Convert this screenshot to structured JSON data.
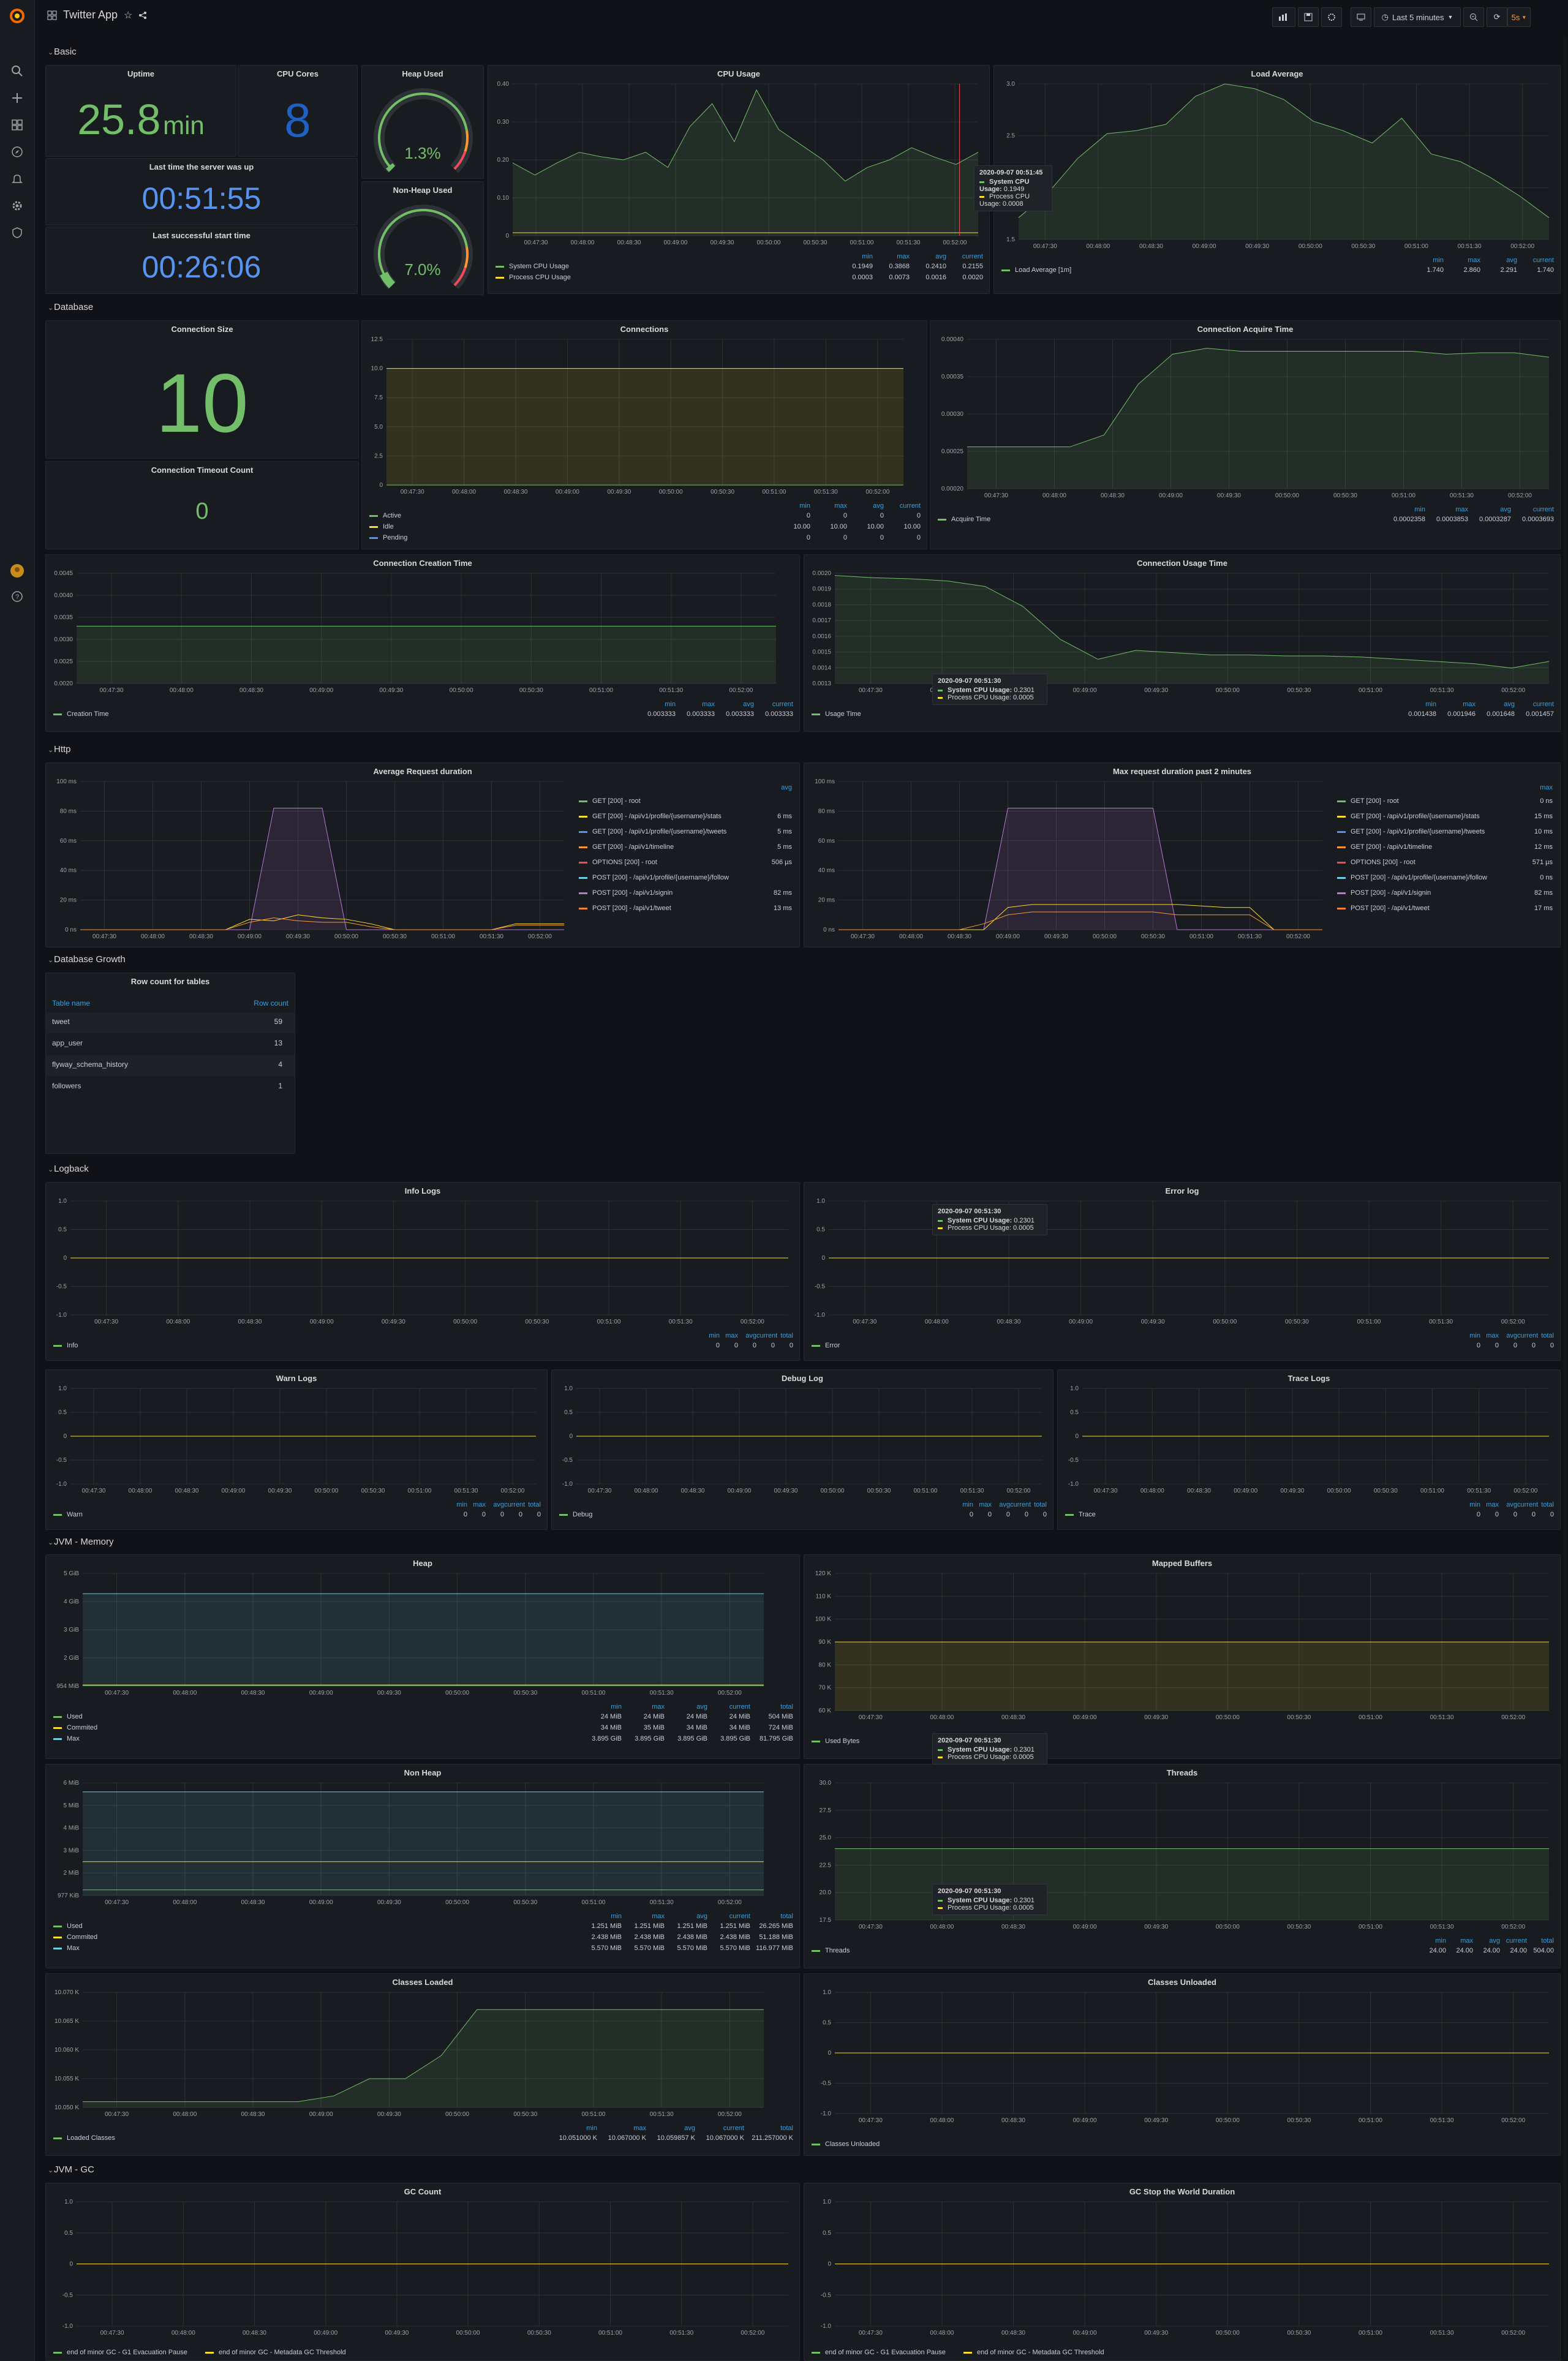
{
  "app": {
    "title": "Twitter App",
    "time_range": "Last 5 minutes",
    "refresh": "5s"
  },
  "rows": {
    "basic": "Basic",
    "database": "Database",
    "http": "Http",
    "db_growth": "Database Growth",
    "logback": "Logback",
    "jvm_memory": "JVM - Memory",
    "jvm_gc": "JVM - GC"
  },
  "time_ticks": [
    "00:47:30",
    "00:48:00",
    "00:48:30",
    "00:49:00",
    "00:49:30",
    "00:50:00",
    "00:50:30",
    "00:51:00",
    "00:51:30",
    "00:52:00"
  ],
  "stats": {
    "uptime": {
      "title": "Uptime",
      "value": "25.8",
      "unit": "min"
    },
    "cpu_cores": {
      "title": "CPU Cores",
      "value": "8"
    },
    "heap_used": {
      "title": "Heap Used",
      "value": "1.3%",
      "level": 0.013
    },
    "nonheap_used": {
      "title": "Non-Heap Used",
      "value": "7.0%",
      "level": 0.07
    },
    "last_up": {
      "title": "Last time the server was up",
      "value": "00:51:55"
    },
    "last_start": {
      "title": "Last successful start time",
      "value": "00:26:06"
    },
    "conn_size": {
      "title": "Connection Size",
      "value": "10"
    },
    "conn_timeout": {
      "title": "Connection Timeout Count",
      "value": "0"
    }
  },
  "panels": {
    "cpu_usage": {
      "title": "CPU Usage",
      "yticks": [
        "0.40",
        "0.30",
        "0.20",
        "0.10",
        "0"
      ],
      "legend_heads": [
        "min",
        "max",
        "avg",
        "current"
      ],
      "legend": [
        {
          "name": "System CPU Usage",
          "vals": [
            "0.1949",
            "0.3868",
            "0.2410",
            "0.2155"
          ]
        },
        {
          "name": "Process CPU Usage",
          "vals": [
            "0.0003",
            "0.0073",
            "0.0016",
            "0.0020"
          ]
        }
      ]
    },
    "load_avg": {
      "title": "Load Average",
      "yticks": [
        "3.0",
        "2.5",
        "2.0",
        "1.5"
      ],
      "legend_heads": [
        "min",
        "max",
        "avg",
        "current"
      ],
      "legend": [
        {
          "name": "Load Average [1m]",
          "vals": [
            "1.740",
            "2.860",
            "2.291",
            "1.740"
          ]
        }
      ]
    },
    "connections": {
      "title": "Connections",
      "yticks": [
        "12.5",
        "10.0",
        "7.5",
        "5.0",
        "2.5",
        "0"
      ],
      "legend_heads": [
        "min",
        "max",
        "avg",
        "current"
      ],
      "legend": [
        {
          "name": "Active",
          "vals": [
            "0",
            "0",
            "0",
            "0"
          ]
        },
        {
          "name": "Idle",
          "vals": [
            "10.00",
            "10.00",
            "10.00",
            "10.00"
          ]
        },
        {
          "name": "Pending",
          "vals": [
            "0",
            "0",
            "0",
            "0"
          ]
        }
      ]
    },
    "conn_acquire": {
      "title": "Connection Acquire Time",
      "yticks": [
        "0.00040",
        "0.00035",
        "0.00030",
        "0.00025",
        "0.00020"
      ],
      "legend_heads": [
        "min",
        "max",
        "avg",
        "current"
      ],
      "legend": [
        {
          "name": "Acquire Time",
          "vals": [
            "0.0002358",
            "0.0003853",
            "0.0003287",
            "0.0003693"
          ]
        }
      ]
    },
    "conn_creation": {
      "title": "Connection Creation Time",
      "yticks": [
        "0.0045",
        "0.0040",
        "0.0035",
        "0.0030",
        "0.0025",
        "0.0020"
      ],
      "legend_heads": [
        "min",
        "max",
        "avg",
        "current"
      ],
      "legend": [
        {
          "name": "Creation Time",
          "vals": [
            "0.003333",
            "0.003333",
            "0.003333",
            "0.003333"
          ]
        }
      ]
    },
    "conn_usage": {
      "title": "Connection Usage Time",
      "yticks": [
        "0.0020",
        "0.0019",
        "0.0018",
        "0.0017",
        "0.0016",
        "0.0015",
        "0.0014",
        "0.0013"
      ],
      "legend_heads": [
        "min",
        "max",
        "avg",
        "current"
      ],
      "legend": [
        {
          "name": "Usage Time",
          "vals": [
            "0.001438",
            "0.001946",
            "0.001648",
            "0.001457"
          ]
        }
      ]
    },
    "avg_req": {
      "title": "Average Request duration",
      "yticks": [
        "100 ms",
        "80 ms",
        "60 ms",
        "40 ms",
        "20 ms",
        "0 ns"
      ],
      "legend_head": "avg",
      "legend": [
        {
          "name": "GET [200] - root",
          "val": ""
        },
        {
          "name": "GET [200] - /api/v1/profile/{username}/stats",
          "val": "6 ms"
        },
        {
          "name": "GET [200] - /api/v1/profile/{username}/tweets",
          "val": "5 ms"
        },
        {
          "name": "GET [200] - /api/v1/timeline",
          "val": "5 ms"
        },
        {
          "name": "OPTIONS [200] - root",
          "val": "506 µs"
        },
        {
          "name": "POST [200] - /api/v1/profile/{username}/follow",
          "val": ""
        },
        {
          "name": "POST [200] - /api/v1/signin",
          "val": "82 ms"
        },
        {
          "name": "POST [200] - /api/v1/tweet",
          "val": "13 ms"
        }
      ]
    },
    "max_req": {
      "title": "Max request duration past 2 minutes",
      "yticks": [
        "100 ms",
        "80 ms",
        "60 ms",
        "40 ms",
        "20 ms",
        "0 ns"
      ],
      "legend_head": "max",
      "legend": [
        {
          "name": "GET [200] - root",
          "val": "0 ns"
        },
        {
          "name": "GET [200] - /api/v1/profile/{username}/stats",
          "val": "15 ms"
        },
        {
          "name": "GET [200] - /api/v1/profile/{username}/tweets",
          "val": "10 ms"
        },
        {
          "name": "GET [200] - /api/v1/timeline",
          "val": "12 ms"
        },
        {
          "name": "OPTIONS [200] - root",
          "val": "571 µs"
        },
        {
          "name": "POST [200] - /api/v1/profile/{username}/follow",
          "val": "0 ns"
        },
        {
          "name": "POST [200] - /api/v1/signin",
          "val": "82 ms"
        },
        {
          "name": "POST [200] - /api/v1/tweet",
          "val": "17 ms"
        }
      ]
    },
    "row_count": {
      "title": "Row count for tables",
      "col1": "Table name",
      "col2": "Row count",
      "rows": [
        {
          "name": "tweet",
          "count": "59"
        },
        {
          "name": "app_user",
          "count": "13"
        },
        {
          "name": "flyway_schema_history",
          "count": "4"
        },
        {
          "name": "followers",
          "count": "1"
        }
      ]
    },
    "info_logs": {
      "title": "Info Logs",
      "series": "Info"
    },
    "error_log": {
      "title": "Error log",
      "series": "Error"
    },
    "warn_logs": {
      "title": "Warn Logs",
      "series": "Warn"
    },
    "debug_log": {
      "title": "Debug Log",
      "series": "Debug"
    },
    "trace_logs": {
      "title": "Trace Logs",
      "series": "Trace"
    },
    "log_heads": [
      "min",
      "max",
      "avg",
      "current",
      "total"
    ],
    "log_vals": [
      "0",
      "0",
      "0",
      "0",
      "0"
    ],
    "log_yticks": [
      "1.0",
      "0.5",
      "0",
      "-0.5",
      "-1.0"
    ],
    "heap": {
      "title": "Heap",
      "yticks": [
        "5 GiB",
        "4 GiB",
        "3 GiB",
        "2 GiB",
        "954 MiB"
      ],
      "legend_heads": [
        "min",
        "max",
        "avg",
        "current",
        "total"
      ],
      "legend": [
        {
          "name": "Used",
          "vals": [
            "24 MiB",
            "24 MiB",
            "24 MiB",
            "24 MiB",
            "504 MiB"
          ]
        },
        {
          "name": "Commited",
          "vals": [
            "34 MiB",
            "35 MiB",
            "34 MiB",
            "34 MiB",
            "724 MiB"
          ]
        },
        {
          "name": "Max",
          "vals": [
            "3.895 GiB",
            "3.895 GiB",
            "3.895 GiB",
            "3.895 GiB",
            "81.795 GiB"
          ]
        }
      ]
    },
    "mapped": {
      "title": "Mapped Buffers",
      "yticks": [
        "120 K",
        "110 K",
        "100 K",
        "90 K",
        "80 K",
        "70 K",
        "60 K"
      ],
      "legend": [
        {
          "name": "Used Bytes"
        }
      ]
    },
    "nonheap": {
      "title": "Non Heap",
      "yticks": [
        "6 MiB",
        "5 MiB",
        "4 MiB",
        "3 MiB",
        "2 MiB",
        "977 KiB"
      ],
      "legend_heads": [
        "min",
        "max",
        "avg",
        "current",
        "total"
      ],
      "legend": [
        {
          "name": "Used",
          "vals": [
            "1.251 MiB",
            "1.251 MiB",
            "1.251 MiB",
            "1.251 MiB",
            "26.265 MiB"
          ]
        },
        {
          "name": "Commited",
          "vals": [
            "2.438 MiB",
            "2.438 MiB",
            "2.438 MiB",
            "2.438 MiB",
            "51.188 MiB"
          ]
        },
        {
          "name": "Max",
          "vals": [
            "5.570 MiB",
            "5.570 MiB",
            "5.570 MiB",
            "5.570 MiB",
            "116.977 MiB"
          ]
        }
      ]
    },
    "threads": {
      "title": "Threads",
      "yticks": [
        "30.0",
        "27.5",
        "25.0",
        "22.5",
        "20.0",
        "17.5"
      ],
      "legend_heads": [
        "min",
        "max",
        "avg",
        "current",
        "total"
      ],
      "legend": [
        {
          "name": "Threads",
          "vals": [
            "24.00",
            "24.00",
            "24.00",
            "24.00",
            "504.00"
          ]
        }
      ]
    },
    "classes_loaded": {
      "title": "Classes Loaded",
      "yticks": [
        "10.070 K",
        "10.065 K",
        "10.060 K",
        "10.055 K",
        "10.050 K"
      ],
      "legend_heads": [
        "min",
        "max",
        "avg",
        "current",
        "total"
      ],
      "legend": [
        {
          "name": "Loaded Classes",
          "vals": [
            "10.051000 K",
            "10.067000 K",
            "10.059857 K",
            "10.067000 K",
            "211.257000 K"
          ]
        }
      ]
    },
    "classes_unloaded": {
      "title": "Classes Unloaded",
      "legend": [
        {
          "name": "Classes Unloaded"
        }
      ]
    },
    "gc_count": {
      "title": "GC Count"
    },
    "gc_stw": {
      "title": "GC Stop the World Duration"
    },
    "gc_legend": [
      "end of minor GC - G1 Evacuation Pause",
      "end of minor GC - Metadata GC Threshold"
    ]
  },
  "tooltips": {
    "cpu": {
      "time": "2020-09-07 00:51:45",
      "sys_label": "System CPU Usage:",
      "sys": "0.1949",
      "proc_label": "Process CPU Usage:",
      "proc": "0.0008"
    },
    "generic": {
      "time": "2020-09-07 00:51:30",
      "sys_label": "System CPU Usage:",
      "sys": "0.2301",
      "proc_label": "Process CPU Usage:",
      "proc": "0.0005"
    }
  },
  "colors": {
    "green": "#73bf69",
    "blue": "#5794f2",
    "yellow": "#fade2a",
    "orange": "#ff9830",
    "red": "#f2495c",
    "purple": "#b877d9",
    "link": "#33a2e5"
  }
}
